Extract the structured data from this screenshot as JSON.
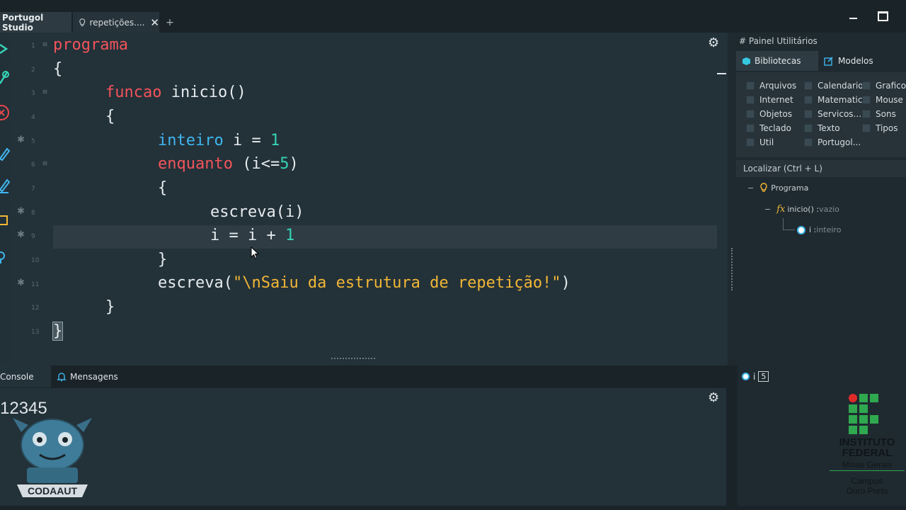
{
  "app": {
    "name": "Portugol Studio"
  },
  "tabs": [
    {
      "label": "repetições...."
    }
  ],
  "editor": {
    "line_numbers": [
      "1",
      "2",
      "3",
      "4",
      "5",
      "6",
      "7",
      "8",
      "9",
      "10",
      "11",
      "12",
      "13"
    ],
    "lines": {
      "l1": "programa",
      "l2": "{",
      "l3_kw": "funcao",
      "l3_rest": " inicio()",
      "l4": "{",
      "l5_kw": "inteiro",
      "l5_mid": " i = ",
      "l5_num": "1",
      "l6_kw": "enquanto",
      "l6_a": " (i<=",
      "l6_num": "5",
      "l6_b": ")",
      "l7": "{",
      "l8": "escreva(i)",
      "l9_a": "i = i + ",
      "l9_num": "1",
      "l10": "}",
      "l11_a": "escreva(",
      "l11_str": "\"\\nSaiu da estrutura de repetição!\"",
      "l11_b": ")",
      "l12": "}",
      "l13": "}"
    }
  },
  "right_panel": {
    "title": "# Painel Utilitários",
    "tabs": {
      "libraries": "Bibliotecas",
      "models": "Modelos"
    },
    "libraries": [
      "Arquivos",
      "Calendario",
      "Graficos",
      "Internet",
      "Matematica",
      "Mouse",
      "Objetos",
      "Servicos...",
      "Sons",
      "Teclado",
      "Texto",
      "Tipos",
      "Util",
      "Portugol..."
    ],
    "search_label": "Localizar (Ctrl + L)",
    "tree": {
      "program": "Programa",
      "func_name": "inicio() : ",
      "func_type": "vazio",
      "var_name": "i : ",
      "var_type": "inteiro"
    }
  },
  "bottom": {
    "tabs": {
      "console": "Console",
      "messages": "Mensagens"
    },
    "console_output": "12345",
    "variable": {
      "name": "i",
      "value": "5"
    }
  },
  "logos": {
    "codaaut": "CODAAUT",
    "ifmg_line1": "INSTITUTO",
    "ifmg_line2": "FEDERAL",
    "ifmg_line3": "Minas Gerais",
    "ifmg_line4": "Campus",
    "ifmg_line5": "Ouro Preto"
  },
  "colors": {
    "keyword": "#f2545b",
    "type": "#3fb6ee",
    "number": "#35d3b5",
    "string": "#f2b736"
  }
}
